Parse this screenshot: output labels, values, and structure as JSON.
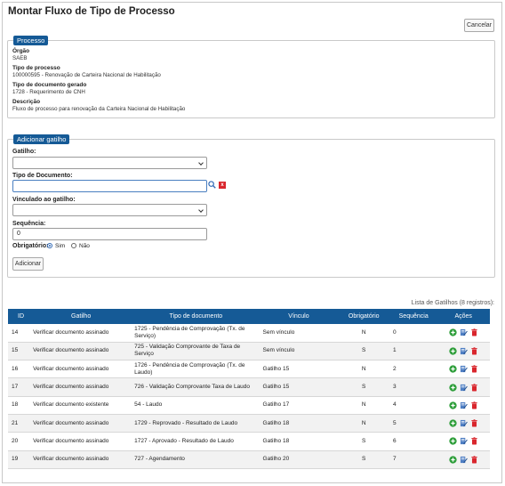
{
  "page": {
    "title": "Montar Fluxo de Tipo de Processo"
  },
  "toolbar": {
    "cancel_label": "Cancelar"
  },
  "processo": {
    "legend": "Processo",
    "orgao_label": "Órgão",
    "orgao_value": "SAEB",
    "tipo_label": "Tipo de processo",
    "tipo_value": "100000595 - Renovação de Carteira Nacional de Habilitação",
    "doc_label": "Tipo de documento gerado",
    "doc_value": "1728 - Requerimento de CNH",
    "desc_label": "Descrição",
    "desc_value": "Fluxo de processo para renovação da Carteira Nacional de Habilitação"
  },
  "form": {
    "legend": "Adicionar gatilho",
    "gatilho_label": "Gatilho:",
    "gatilho_value": "",
    "tipo_doc_label": "Tipo de Documento:",
    "tipo_doc_value": "",
    "clear_label": "x",
    "vinculado_label": "Vinculado ao gatilho:",
    "vinculado_value": "",
    "sequencia_label": "Sequência:",
    "sequencia_value": "0",
    "obrigatorio_label": "Obrigatório:",
    "sim_label": "Sim",
    "nao_label": "Não",
    "obrigatorio_value": "Sim",
    "add_label": "Adicionar"
  },
  "table": {
    "caption": "Lista de Gatilhos (8 registros):",
    "headers": [
      "ID",
      "Gatilho",
      "Tipo de documento",
      "Vínculo",
      "Obrigatório",
      "Sequência",
      "Ações"
    ],
    "rows": [
      {
        "id": "14",
        "gatilho": "Verificar documento assinado",
        "doc_code": "1725",
        "doc_name": " - Pendência de Comprovação (Tx. de Serviço)",
        "vinculo": "Sem vínculo",
        "obrigatorio": "N",
        "sequencia": "0"
      },
      {
        "id": "15",
        "gatilho": "Verificar documento assinado",
        "doc_code": "725",
        "doc_name": " - Validação Comprovante de Taxa de Serviço",
        "vinculo": "Sem vínculo",
        "obrigatorio": "S",
        "sequencia": "1"
      },
      {
        "id": "16",
        "gatilho": "Verificar documento assinado",
        "doc_code": "1726",
        "doc_name": " - Pendência de Comprovação (Tx. de Laudo)",
        "vinculo": "Gatilho 15",
        "obrigatorio": "N",
        "sequencia": "2"
      },
      {
        "id": "17",
        "gatilho": "Verificar documento assinado",
        "doc_code": "726",
        "doc_name": " - Validação Comprovante Taxa de Laudo",
        "vinculo": "Gatilho 15",
        "obrigatorio": "S",
        "sequencia": "3"
      },
      {
        "id": "18",
        "gatilho": "Verificar documento existente",
        "doc_code": "54",
        "doc_name": " - Laudo",
        "vinculo": "Gatilho 17",
        "obrigatorio": "N",
        "sequencia": "4"
      },
      {
        "id": "21",
        "gatilho": "Verificar documento assinado",
        "doc_code": "1729",
        "doc_name": " - Reprovado - Resultado de Laudo",
        "vinculo": "Gatilho 18",
        "obrigatorio": "N",
        "sequencia": "5"
      },
      {
        "id": "20",
        "gatilho": "Verificar documento assinado",
        "doc_code": "1727",
        "doc_name": " - Aprovado - Resultado de Laudo",
        "vinculo": "Gatilho 18",
        "obrigatorio": "S",
        "sequencia": "6"
      },
      {
        "id": "19",
        "gatilho": "Verificar documento assinado",
        "doc_code": "727",
        "doc_name": " - Agendamento",
        "vinculo": "Gatilho 20",
        "obrigatorio": "S",
        "sequencia": "7"
      }
    ],
    "action_icons": [
      "plus-circle-icon",
      "edit-icon",
      "trash-icon"
    ]
  },
  "colors": {
    "accent": "#155a96",
    "add": "#2e9e3a",
    "edit": "#2f68b5",
    "delete": "#d9262d"
  }
}
